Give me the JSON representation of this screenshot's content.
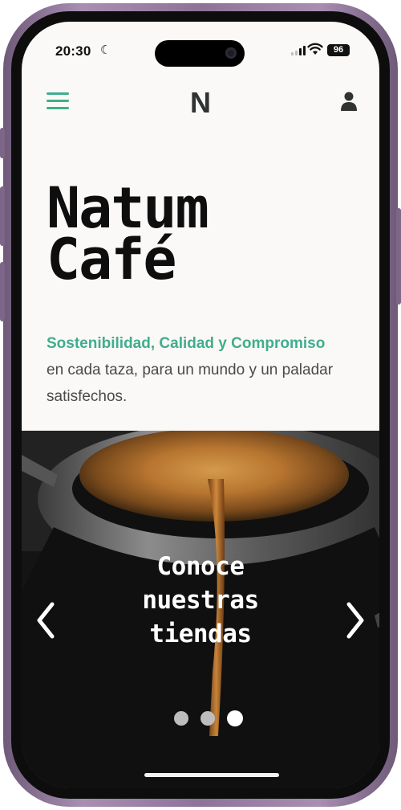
{
  "status_bar": {
    "time": "20:30",
    "focus_icon": "moon-icon",
    "battery": "96"
  },
  "nav": {
    "menu_icon": "hamburger-menu-icon",
    "logo": "N",
    "account_icon": "user-icon"
  },
  "hero": {
    "title_line1": "Natum",
    "title_line2": "Café",
    "tagline_accent": "Sostenibilidad, Calidad y Compromiso",
    "tagline_rest": "en cada taza, para un mundo y un paladar satisfechos."
  },
  "carousel": {
    "slide_line1": "Conoce",
    "slide_line2": "nuestras",
    "slide_line3": "tiendas",
    "prev_icon": "chevron-left-icon",
    "next_icon": "chevron-right-icon",
    "slide_count": 3,
    "active_slide": 3
  },
  "colors": {
    "accent": "#3fae8c",
    "page_bg": "#fbf9f7",
    "frame": "#8d7398"
  }
}
